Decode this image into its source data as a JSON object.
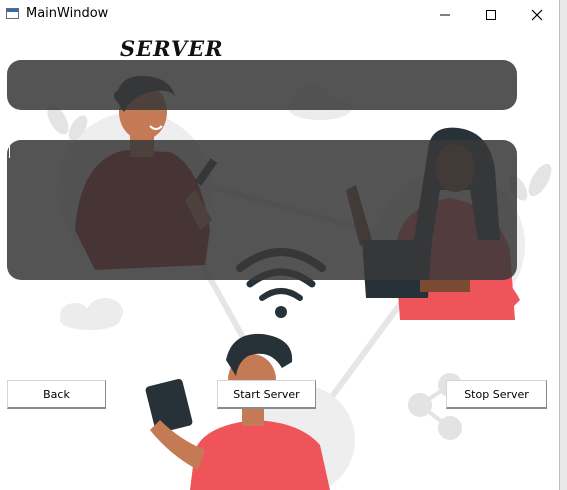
{
  "window": {
    "title": "MainWindow",
    "controls": {
      "minimize": "minimize",
      "maximize": "maximize",
      "close": "close"
    }
  },
  "heading": "SERVER",
  "buttons": {
    "back": "Back",
    "start": "Start Server",
    "stop": "Stop Server"
  },
  "theme": {
    "panel_color": "#383838",
    "accent_red": "#f0545b",
    "dark_accent": "#263238",
    "skin": "#c47a55"
  }
}
